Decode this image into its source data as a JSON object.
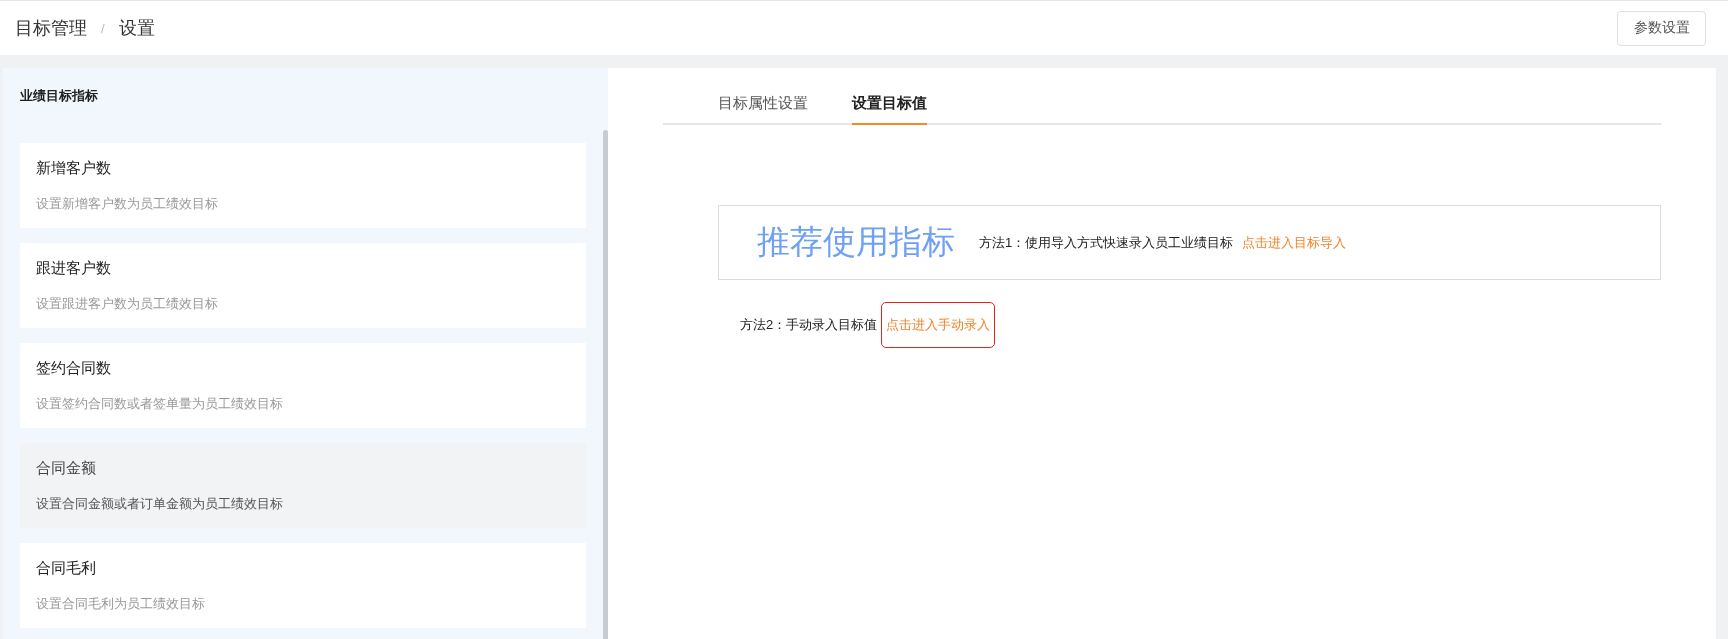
{
  "breadcrumb": [
    "目标管理",
    "设置"
  ],
  "breadcrumb_separator": "/",
  "header_button": "参数设置",
  "sidebar": {
    "title": "业绩目标指标",
    "items": [
      {
        "title": "新增客户数",
        "description": "设置新增客户数为员工绩效目标",
        "selected": false
      },
      {
        "title": "跟进客户数",
        "description": "设置跟进客户数为员工绩效目标",
        "selected": false
      },
      {
        "title": "签约合同数",
        "description": "设置签约合同数或者签单量为员工绩效目标",
        "selected": false
      },
      {
        "title": "合同金额",
        "description": "设置合同金额或者订单金额为员工绩效目标",
        "selected": true
      },
      {
        "title": "合同毛利",
        "description": "设置合同毛利为员工绩效目标",
        "selected": false
      }
    ]
  },
  "tabs": [
    {
      "label": "目标属性设置",
      "selected": false
    },
    {
      "label": "设置目标值",
      "selected": true
    }
  ],
  "recommend": {
    "heading": "推荐使用指标",
    "text": "方法1：使用导入方式快速录入员工业绩目标",
    "link": "点击进入目标导入",
    "highlighted": false
  },
  "method2": {
    "text": "方法2：手动录入目标值",
    "link": "点击进入手动录入",
    "highlighted": true
  }
}
